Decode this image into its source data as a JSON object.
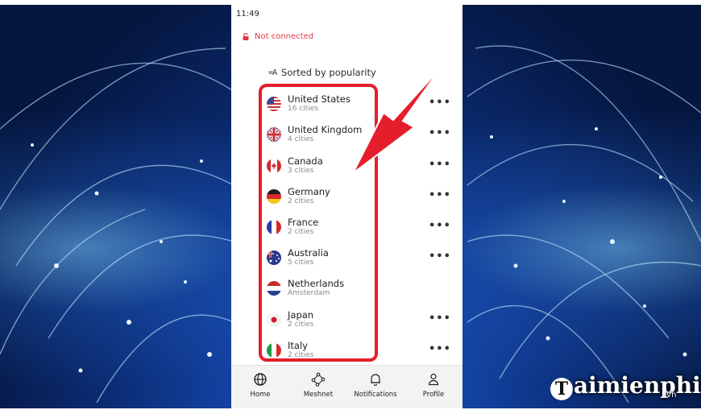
{
  "status": {
    "time": "11:49",
    "connection": "Not connected"
  },
  "list": {
    "sort_label": "Sorted by popularity",
    "sort_icon_text": "=A",
    "countries": [
      {
        "name": "United States",
        "sub": "16 cities",
        "flag": "us-flag",
        "more": "•••"
      },
      {
        "name": "United Kingdom",
        "sub": "4 cities",
        "flag": "uk-flag",
        "more": "•••"
      },
      {
        "name": "Canada",
        "sub": "3 cities",
        "flag": "canada-flag",
        "more": "•••"
      },
      {
        "name": "Germany",
        "sub": "2 cities",
        "flag": "germany-flag",
        "more": "•••"
      },
      {
        "name": "France",
        "sub": "2 cities",
        "flag": "france-flag",
        "more": "•••"
      },
      {
        "name": "Australia",
        "sub": "5 cities",
        "flag": "australia-flag",
        "more": "•••"
      },
      {
        "name": "Netherlands",
        "sub": "Amsterdam",
        "flag": "netherlands-flag",
        "more": ""
      },
      {
        "name": "Japan",
        "sub": "2 cities",
        "flag": "japan-flag",
        "more": "•••"
      },
      {
        "name": "Italy",
        "sub": "2 cities",
        "flag": "italy-flag",
        "more": "•••"
      }
    ]
  },
  "nav": {
    "items": [
      {
        "label": "Home",
        "icon": "globe-icon"
      },
      {
        "label": "Meshnet",
        "icon": "meshnet-icon"
      },
      {
        "label": "Notifications",
        "icon": "bell-icon"
      },
      {
        "label": "Profile",
        "icon": "profile-icon"
      }
    ]
  },
  "watermark": {
    "logo_letter": "T",
    "text": "aimienphi",
    "sub": ".vn"
  },
  "colors": {
    "accent_red": "#e41e2b",
    "disconnected": "#e5374a",
    "background_blue": "#0c2f7a"
  }
}
